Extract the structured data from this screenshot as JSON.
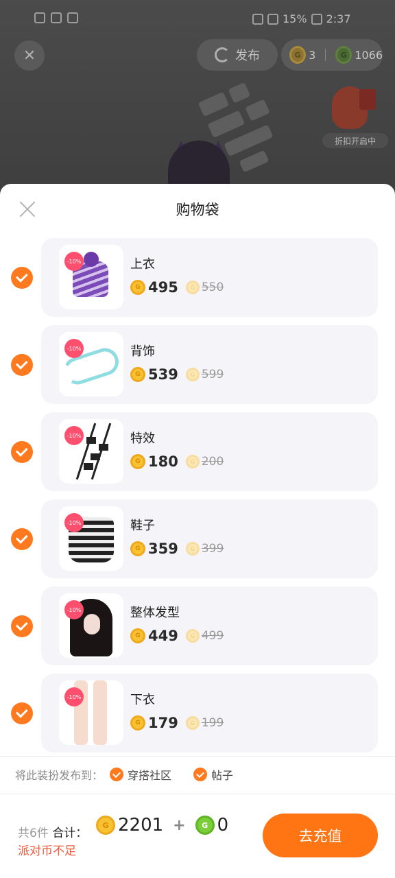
{
  "statusbar": {
    "battery": "15%",
    "time": "2:37"
  },
  "topbar": {
    "publish_label": "发布",
    "currency_a": "3",
    "currency_b": "1066",
    "promo_label": "折扣开启中"
  },
  "sheet": {
    "title": "购物袋",
    "items": [
      {
        "name": "上衣",
        "price": "495",
        "old_price": "550",
        "badge": "-10%",
        "icon": "hoodie-thumbnail"
      },
      {
        "name": "背饰",
        "price": "539",
        "old_price": "599",
        "badge": "-10%",
        "icon": "dragon-thumbnail"
      },
      {
        "name": "特效",
        "price": "180",
        "old_price": "200",
        "badge": "-10%",
        "icon": "effect-thumbnail"
      },
      {
        "name": "鞋子",
        "price": "359",
        "old_price": "399",
        "badge": "-10%",
        "icon": "boots-thumbnail"
      },
      {
        "name": "整体发型",
        "price": "449",
        "old_price": "499",
        "badge": "-10%",
        "icon": "hair-thumbnail"
      },
      {
        "name": "下衣",
        "price": "179",
        "old_price": "199",
        "badge": "-10%",
        "icon": "legs-thumbnail"
      }
    ],
    "publish_to": {
      "label": "将此装扮发布到：",
      "options": [
        "穿搭社区",
        "帖子"
      ]
    },
    "footer": {
      "count": "共6件",
      "total_label": "合计：",
      "total_coins": "2201",
      "plus": "+",
      "total_gcoins": "0",
      "warning": "派对币不足",
      "button": "去充值"
    }
  },
  "colors": {
    "accent": "#ff7a1f",
    "badge": "#ff4f6e",
    "warning": "#f05a3a"
  }
}
